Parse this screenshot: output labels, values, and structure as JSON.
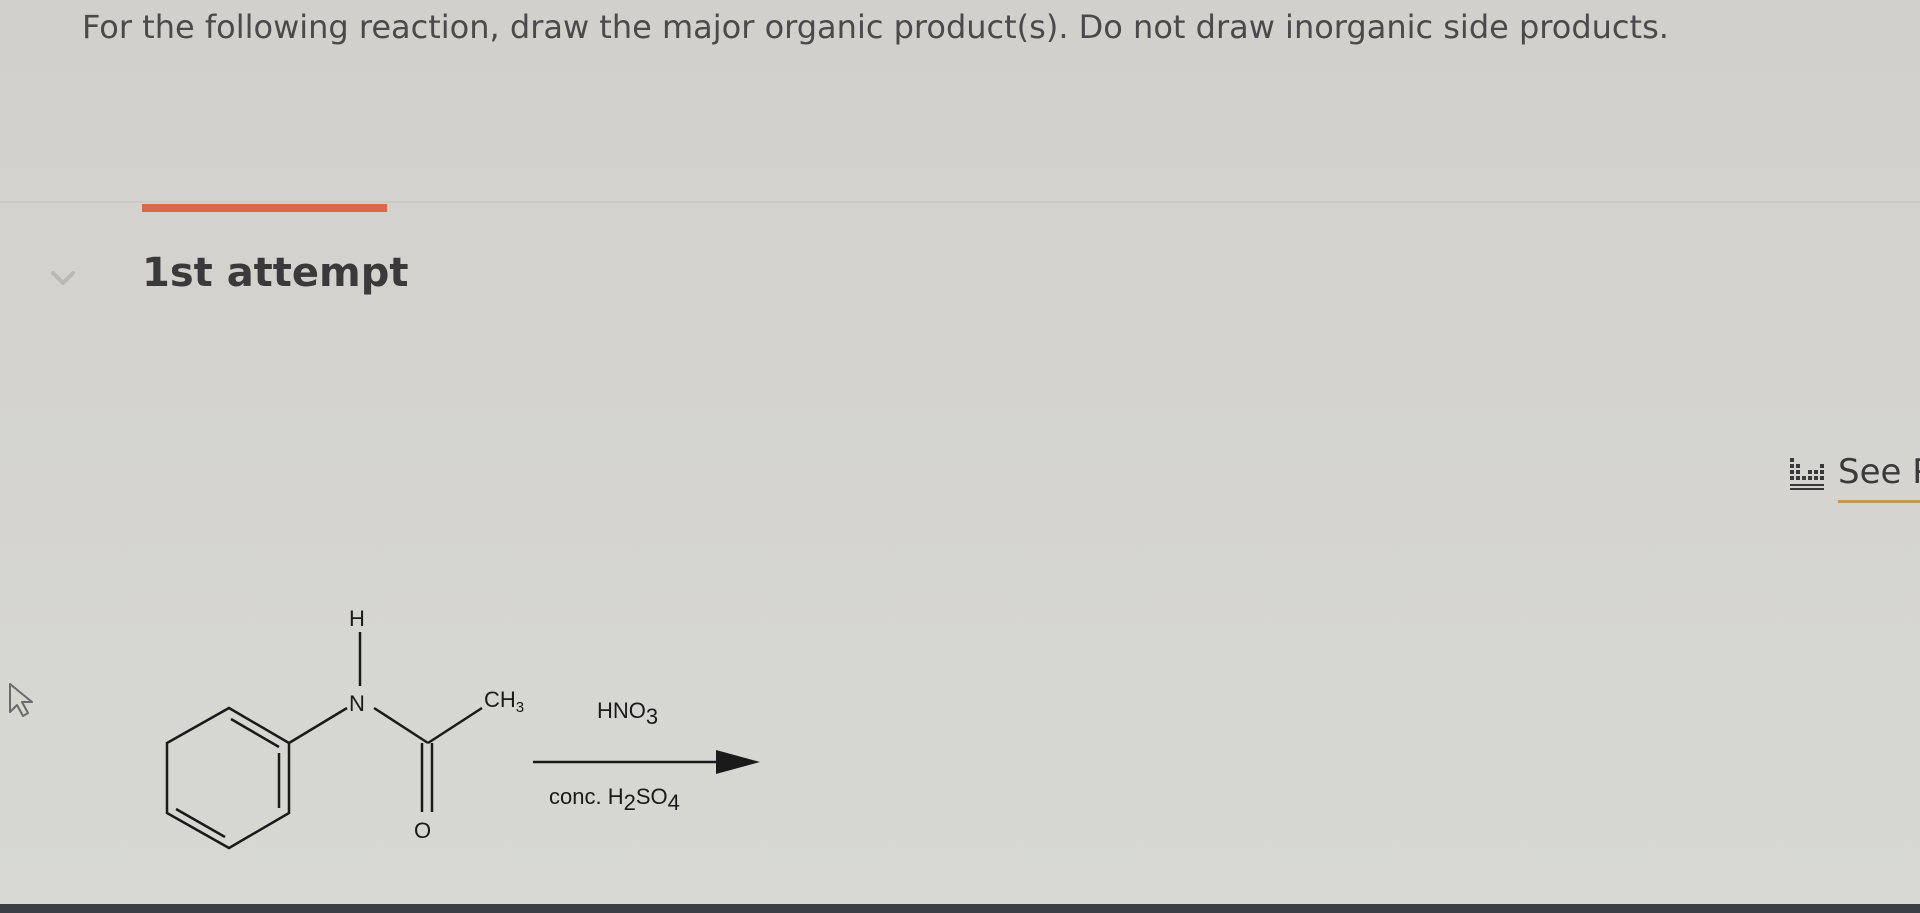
{
  "question": {
    "text": "For the following reaction, draw the major organic product(s). Do not draw inorganic side products."
  },
  "attempt": {
    "label": "1st attempt"
  },
  "periodic_table_link": {
    "label": "See P"
  },
  "reaction": {
    "atom_h": "H",
    "atom_n": "N",
    "atom_o": "O",
    "ch3": {
      "main": "CH",
      "sub": "3"
    },
    "reagent_top": {
      "main": "HNO",
      "sub": "3"
    },
    "reagent_bottom": {
      "pre": "conc. H",
      "sub1": "2",
      "mid": "SO",
      "sub2": "4"
    }
  },
  "colors": {
    "accent": "#d9694a",
    "link_underline": "#c99a3a",
    "text": "#3a3a3a"
  },
  "icons": {
    "chevron": "chevron-down-icon",
    "periodic_table": "periodic-table-icon",
    "cursor": "mouse-pointer-icon"
  }
}
